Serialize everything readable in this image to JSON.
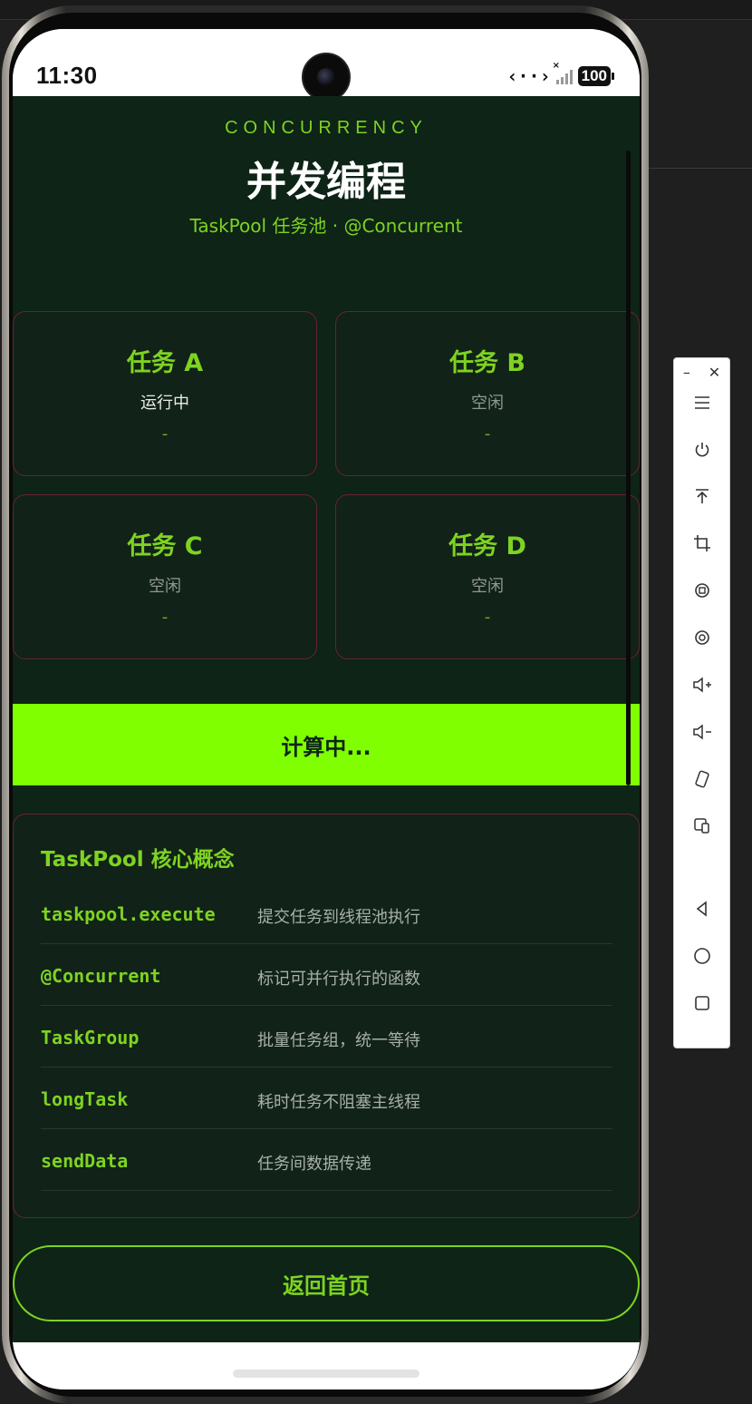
{
  "status_bar": {
    "time": "11:30",
    "code_icon": "‹··›",
    "signal_mark": "×",
    "battery": "100"
  },
  "header": {
    "eyebrow": "CONCURRENCY",
    "title": "并发编程",
    "subtitle": "TaskPool 任务池 · @Concurrent"
  },
  "tasks": [
    {
      "name": "任务 A",
      "state": "运行中",
      "result": "-"
    },
    {
      "name": "任务 B",
      "state": "空闲",
      "result": "-"
    },
    {
      "name": "任务 C",
      "state": "空闲",
      "result": "-"
    },
    {
      "name": "任务 D",
      "state": "空闲",
      "result": "-"
    }
  ],
  "compute_button": "计算中...",
  "concepts": {
    "title": "TaskPool 核心概念",
    "items": [
      {
        "key": "taskpool.execute",
        "desc": "提交任务到线程池执行"
      },
      {
        "key": "@Concurrent",
        "desc": "标记可并行执行的函数"
      },
      {
        "key": "TaskGroup",
        "desc": "批量任务组，统一等待"
      },
      {
        "key": "longTask",
        "desc": "耗时任务不阻塞主线程"
      },
      {
        "key": "sendData",
        "desc": "任务间数据传递"
      }
    ]
  },
  "back_button": "返回首页",
  "toolbar": {
    "minimize": "–",
    "close": "✕",
    "icons": [
      "menu-icon",
      "power-icon",
      "pin-top-icon",
      "crop-icon",
      "rotate-icon",
      "screenshot-icon",
      "volume-up-icon",
      "volume-down-icon",
      "shake-icon",
      "multi-device-icon",
      "back-icon",
      "home-icon",
      "recents-icon"
    ]
  },
  "colors": {
    "accent": "#7ed321",
    "button_fill": "#7fff00",
    "background": "#0d2416",
    "card_border": "#6a2230"
  }
}
